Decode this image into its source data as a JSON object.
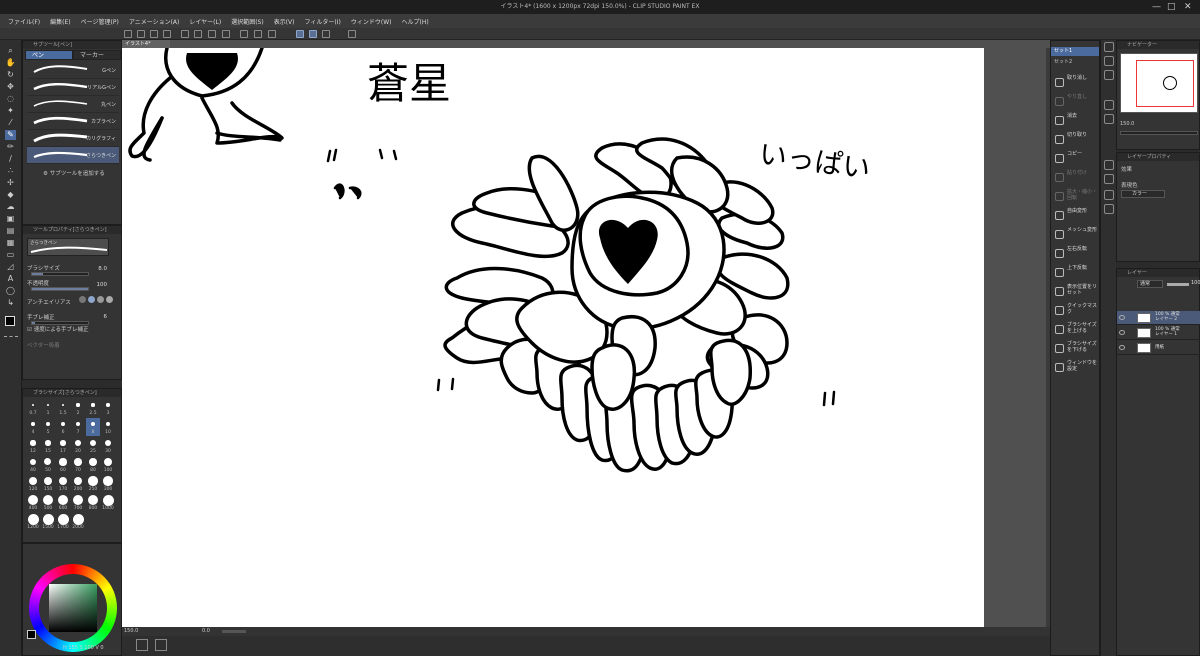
{
  "window": {
    "title": "イラスト4* (1600 x 1200px 72dpi 150.0%)  - CLIP STUDIO PAINT EX",
    "controls": [
      "—",
      "□",
      "✕"
    ]
  },
  "menu": [
    "ファイル(F)",
    "編集(E)",
    "ページ管理(P)",
    "アニメーション(A)",
    "レイヤー(L)",
    "選択範囲(S)",
    "表示(V)",
    "フィルター(I)",
    "ウィンドウ(W)",
    "ヘルプ(H)"
  ],
  "subtool_panel": {
    "header": "サブツール[ペン]",
    "tabs": [
      "ペン",
      "マーカー"
    ],
    "brushes": [
      "Gペン",
      "リアルGペン",
      "丸ペン",
      "カブラペン",
      "カリグラフィ",
      "さらつきペン"
    ],
    "selected_index": 5,
    "add_label": "サブツールを追加する"
  },
  "tool_property": {
    "header": "ツールプロパティ[さらつきペン]",
    "preview_label": "さらつきペン",
    "brush_size_label": "ブラシサイズ",
    "brush_size_value": "8.0",
    "opacity_label": "不透明度",
    "opacity_value": "100",
    "antialias_label": "アンチエイリアス",
    "stabilize_label": "手ブレ補正",
    "stabilize_value": "6",
    "speed_stabilize_label": "速度による手ブレ補正",
    "vector_label": "ベクター吸着"
  },
  "brush_size_palette": {
    "header": "ブラシサイズ[さらつきペン]",
    "sizes": [
      "0.7",
      "1",
      "1.5",
      "2",
      "2.5",
      "3",
      "4",
      "5",
      "6",
      "7",
      "8",
      "10",
      "12",
      "15",
      "17",
      "20",
      "25",
      "30",
      "40",
      "50",
      "60",
      "70",
      "80",
      "100",
      "120",
      "150",
      "170",
      "200",
      "250",
      "300",
      "400",
      "500",
      "600",
      "700",
      "800",
      "1000",
      "1200",
      "1500",
      "1700",
      "2000"
    ],
    "selected": "8"
  },
  "color_panel": {
    "values": [
      "155",
      "100",
      "0"
    ],
    "main_color": "#000000",
    "sub_color": "#ffffff"
  },
  "canvas": {
    "doc_tab": "イラスト4*",
    "drawing_texts": [
      "蒼星",
      "いっぱい"
    ],
    "zoom_status": "150.0",
    "angle_status": "0.0"
  },
  "quick_access": [
    {
      "label": "セット1"
    },
    {
      "label": "セット2"
    },
    {
      "label": "取り消し",
      "enabled": true
    },
    {
      "label": "やり直し",
      "enabled": false
    },
    {
      "label": "消去",
      "enabled": true
    },
    {
      "label": "切り取り",
      "enabled": true
    },
    {
      "label": "コピー",
      "enabled": true
    },
    {
      "label": "貼り付け",
      "enabled": false
    },
    {
      "label": "拡大・縮小・回転",
      "enabled": false
    },
    {
      "label": "自由変形",
      "enabled": true
    },
    {
      "label": "メッシュ変形",
      "enabled": true
    },
    {
      "label": "左右反転",
      "enabled": true
    },
    {
      "label": "上下反転",
      "enabled": true
    },
    {
      "label": "表示位置をリセット",
      "enabled": true
    },
    {
      "label": "クイックマスク",
      "enabled": true
    },
    {
      "label": "ブラシサイズを上げる",
      "enabled": true
    },
    {
      "label": "ブラシサイズを下げる",
      "enabled": true
    },
    {
      "label": "ウィンドウを設定",
      "enabled": true
    }
  ],
  "navigator": {
    "header": "ナビゲーター",
    "zoom": "150.0"
  },
  "layer_property": {
    "header": "レイヤープロパティ",
    "effect_label": "効果",
    "expression_label": "表現色",
    "expression_value": "カラー"
  },
  "layers_panel": {
    "header": "レイヤー",
    "blend": "通常",
    "opacity": "100",
    "layers": [
      {
        "name": "100 % 通常",
        "sub": "レイヤー 2",
        "selected": true
      },
      {
        "name": "100 % 通常",
        "sub": "レイヤー 1",
        "selected": false
      },
      {
        "name": "用紙",
        "sub": "",
        "selected": false
      }
    ]
  },
  "colors": {
    "accent": "#4b6a9d",
    "panel": "#343434",
    "dark": "#2b2b2b",
    "selection": "#4a5a78"
  }
}
